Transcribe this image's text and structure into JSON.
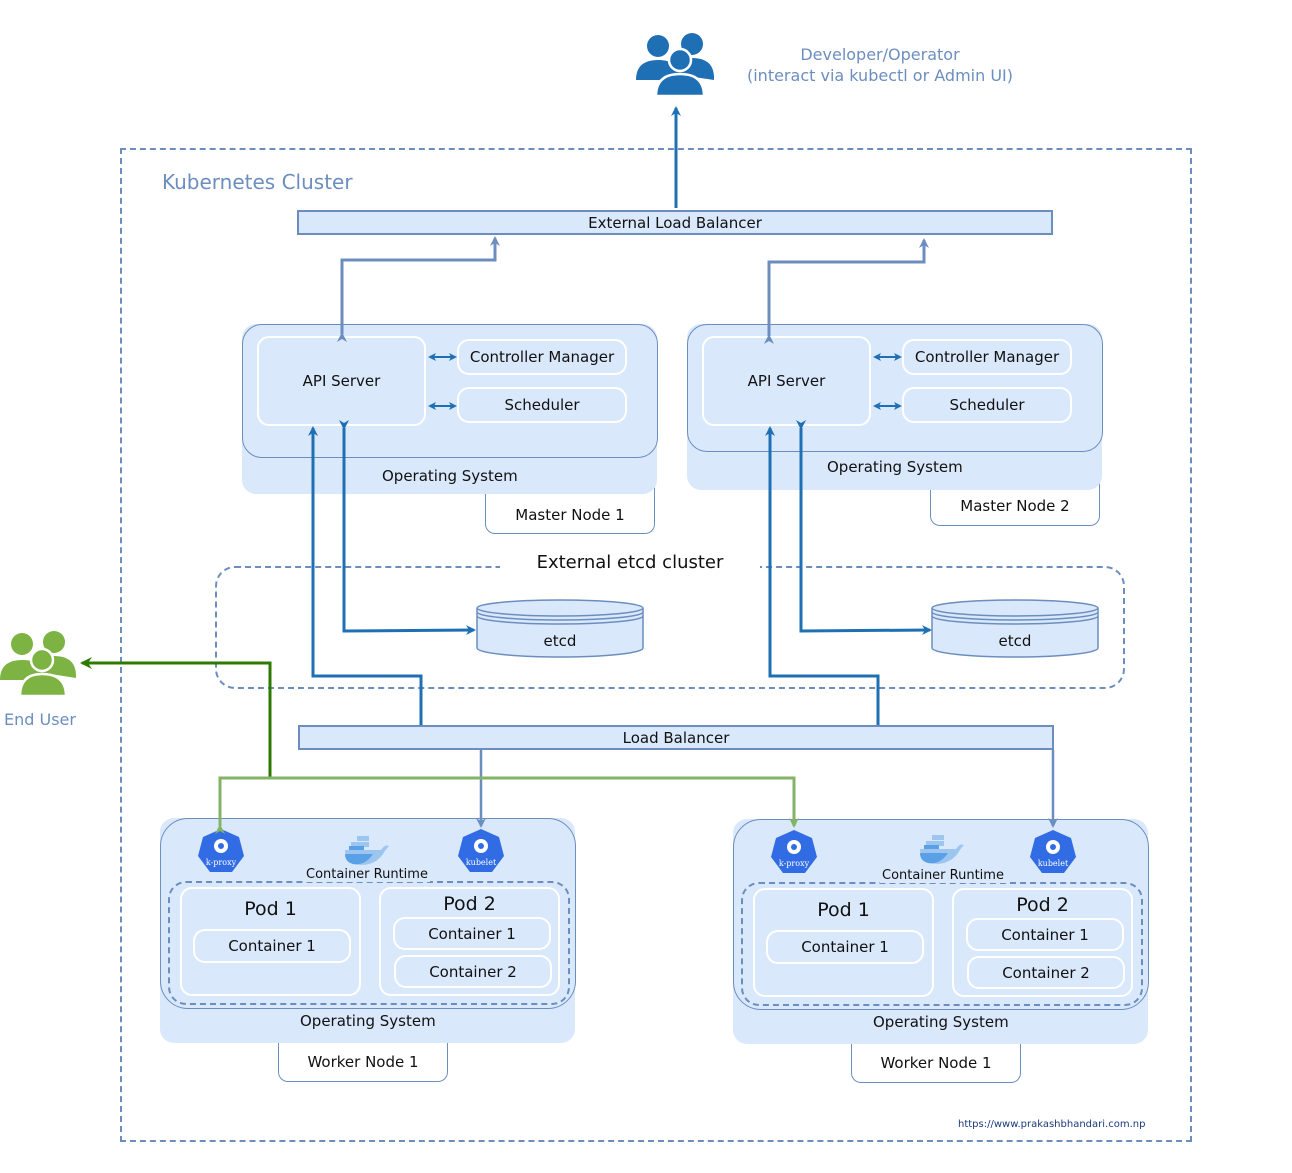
{
  "developer": {
    "icon": "users-group-icon",
    "label_line1": "Developer/Operator",
    "label_line2": "(interact via kubectl or Admin UI)"
  },
  "end_user": {
    "icon": "users-group-icon",
    "label": "End User"
  },
  "cluster": {
    "title": "Kubernetes Cluster"
  },
  "external_load_balancer": {
    "label": "External Load Balancer"
  },
  "load_balancer": {
    "label": "Load Balancer"
  },
  "masters": [
    {
      "api_server": "API Server",
      "controller_manager": "Controller Manager",
      "scheduler": "Scheduler",
      "os": "Operating System",
      "node_label": "Master Node 1"
    },
    {
      "api_server": "API Server",
      "controller_manager": "Controller Manager",
      "scheduler": "Scheduler",
      "os": "Operating System",
      "node_label": "Master Node 2"
    }
  ],
  "etcd_cluster": {
    "title": "External etcd cluster",
    "nodes": [
      "etcd",
      "etcd"
    ]
  },
  "workers": [
    {
      "kproxy": "k-proxy",
      "kubelet": "kubelet",
      "runtime": "Container Runtime",
      "pods": [
        {
          "title": "Pod 1",
          "containers": [
            "Container 1"
          ]
        },
        {
          "title": "Pod 2",
          "containers": [
            "Container 1",
            "Container 2"
          ]
        }
      ],
      "os": "Operating System",
      "node_label": "Worker Node 1"
    },
    {
      "kproxy": "k-proxy",
      "kubelet": "kubelet",
      "runtime": "Container Runtime",
      "pods": [
        {
          "title": "Pod 1",
          "containers": [
            "Container 1"
          ]
        },
        {
          "title": "Pod 2",
          "containers": [
            "Container 1",
            "Container 2"
          ]
        }
      ],
      "os": "Operating System",
      "node_label": "Worker Node 1"
    }
  ],
  "footer": {
    "url": "https://www.prakashbhandari.com.np"
  },
  "colors": {
    "accent_blue": "#1f6fb5",
    "dashed_border": "#6c8ebf",
    "fill_light_blue": "#dae8fc",
    "end_user_green": "#7cb342",
    "green_wire_dark": "#2d7a00",
    "green_wire_light": "#82b366",
    "k8s_blue": "#326ce5"
  }
}
